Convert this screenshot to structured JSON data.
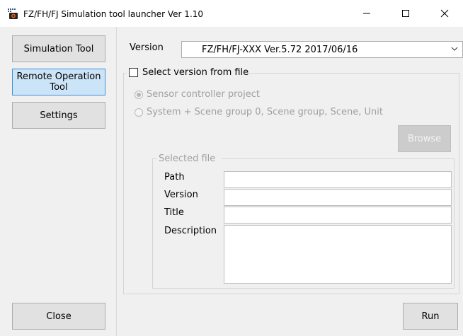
{
  "window": {
    "title": "FZ/FH/FJ Simulation tool launcher Ver 1.10",
    "minimize_icon": "minimize-icon",
    "maximize_icon": "maximize-icon",
    "close_icon": "close-icon"
  },
  "sidebar": {
    "items": [
      {
        "label": "Simulation Tool",
        "active": false
      },
      {
        "label": "Remote Operation Tool",
        "active": true
      },
      {
        "label": "Settings",
        "active": false
      }
    ],
    "close_label": "Close",
    "active_color": "#cce4f7"
  },
  "main": {
    "version_label": "Version",
    "version_value": "FZ/FH/FJ-XXX Ver.5.72 2017/06/16",
    "select_from_file": {
      "label": "Select version from file",
      "checked": false
    },
    "radios": [
      {
        "label": "Sensor controller project",
        "checked": true,
        "enabled": false
      },
      {
        "label": "System + Scene group 0, Scene group, Scene, Unit",
        "checked": false,
        "enabled": false
      }
    ],
    "browse_label": "Browse",
    "selected_file": {
      "legend": "Selected file",
      "path_label": "Path",
      "version_label": "Version",
      "title_label": "Title",
      "description_label": "Description",
      "path_value": "",
      "version_value": "",
      "title_value": "",
      "description_value": ""
    },
    "run_label": "Run"
  }
}
